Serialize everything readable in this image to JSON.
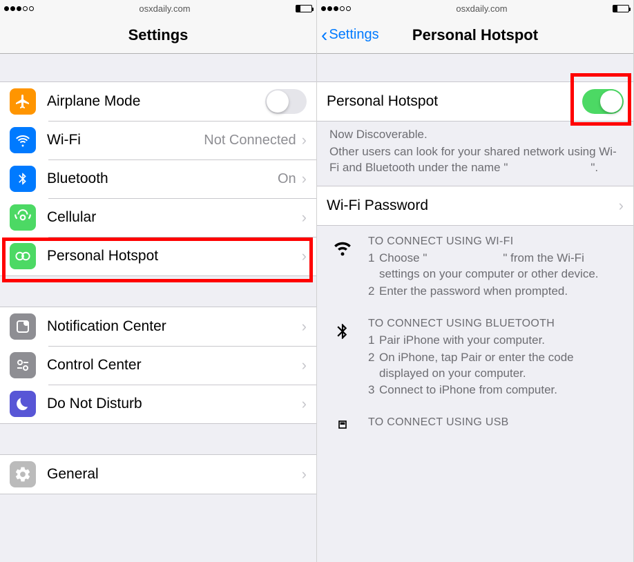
{
  "status": {
    "url": "osxdaily.com"
  },
  "left": {
    "title": "Settings",
    "rows": {
      "airplane": {
        "label": "Airplane Mode"
      },
      "wifi": {
        "label": "Wi-Fi",
        "value": "Not Connected"
      },
      "bluetooth": {
        "label": "Bluetooth",
        "value": "On"
      },
      "cellular": {
        "label": "Cellular"
      },
      "hotspot": {
        "label": "Personal Hotspot"
      },
      "notif": {
        "label": "Notification Center"
      },
      "control": {
        "label": "Control Center"
      },
      "dnd": {
        "label": "Do Not Disturb"
      },
      "general": {
        "label": "General"
      }
    }
  },
  "right": {
    "back": "Settings",
    "title": "Personal Hotspot",
    "toggle_row": {
      "label": "Personal Hotspot",
      "on": true
    },
    "footer": {
      "line1": "Now Discoverable.",
      "line2a": "Other users can look for your shared network using Wi-Fi and Bluetooth under the name \"",
      "line2b": "\"."
    },
    "wifi_pw": {
      "label": "Wi-Fi Password"
    },
    "instr_wifi": {
      "title": "TO CONNECT USING WI-FI",
      "step1a": "Choose \"",
      "step1b": "\" from the Wi-Fi settings on your computer or other device.",
      "step2": "Enter the password when prompted."
    },
    "instr_bt": {
      "title": "TO CONNECT USING BLUETOOTH",
      "step1": "Pair iPhone with your computer.",
      "step2": "On iPhone, tap Pair or enter the code displayed on your computer.",
      "step3": "Connect to iPhone from computer."
    },
    "instr_usb": {
      "title": "TO CONNECT USING USB"
    }
  },
  "numbers": {
    "n1": "1",
    "n2": "2",
    "n3": "3"
  }
}
